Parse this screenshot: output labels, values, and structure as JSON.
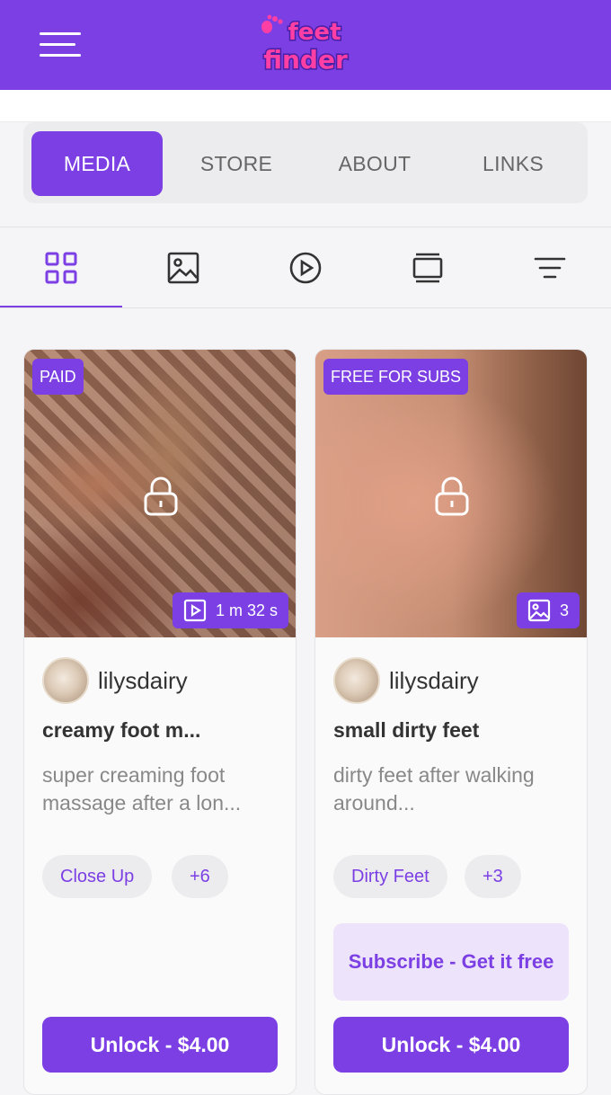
{
  "header": {
    "logo_text": "feet finder",
    "brand_color": "#7b3fe4",
    "logo_color": "#ff3fa4"
  },
  "tabs": [
    {
      "label": "MEDIA",
      "active": true
    },
    {
      "label": "STORE",
      "active": false
    },
    {
      "label": "ABOUT",
      "active": false
    },
    {
      "label": "LINKS",
      "active": false
    }
  ],
  "filters": [
    {
      "icon": "grid-icon",
      "active": true
    },
    {
      "icon": "image-icon",
      "active": false
    },
    {
      "icon": "play-circle-icon",
      "active": false
    },
    {
      "icon": "gallery-icon",
      "active": false
    },
    {
      "icon": "filter-icon",
      "active": false
    }
  ],
  "cards": [
    {
      "badge": "PAID",
      "media_type": "video",
      "media_info": "1 m 32 s",
      "author": "lilysdairy",
      "title": "creamy foot m...",
      "description": "super creaming foot massage after a lon...",
      "tags": [
        "Close Up",
        "+6"
      ],
      "unlock_label": "Unlock - $4.00"
    },
    {
      "badge": "FREE FOR SUBS",
      "media_type": "image",
      "media_info": "3",
      "author": "lilysdairy",
      "title": "small dirty feet",
      "description": "dirty feet after walking around...",
      "tags": [
        "Dirty Feet",
        "+3"
      ],
      "subscribe_label": "Subscribe - Get it free",
      "unlock_label": "Unlock - $4.00"
    }
  ]
}
